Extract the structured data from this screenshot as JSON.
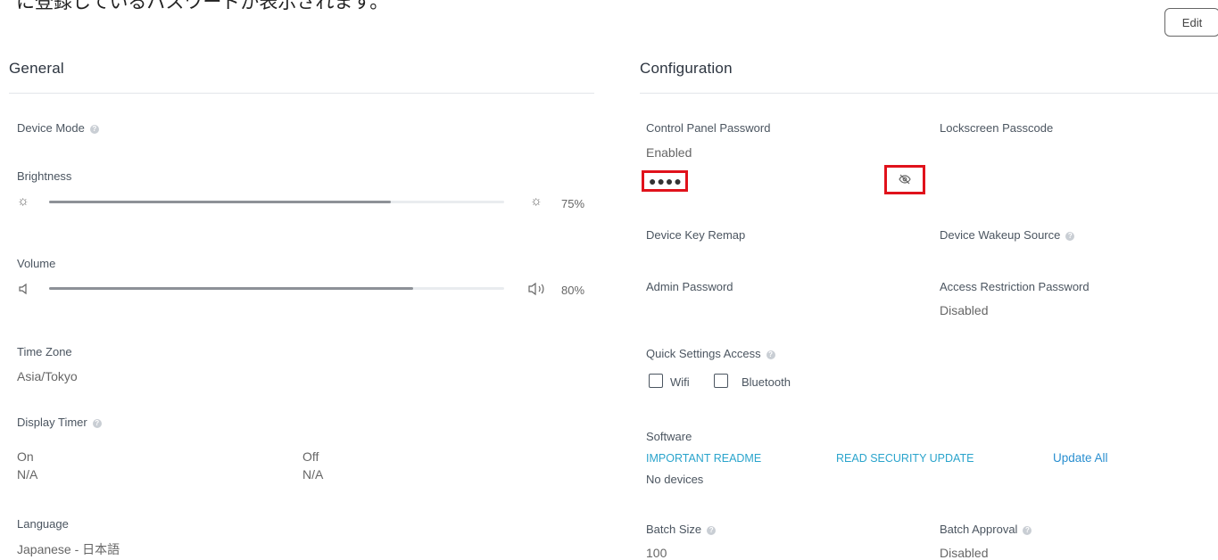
{
  "header": {
    "note_text": "に登録しているパスワードが表示されます。",
    "edit_label": "Edit"
  },
  "general": {
    "title": "General",
    "device_mode_label": "Device Mode",
    "brightness": {
      "label": "Brightness",
      "value_text": "75%",
      "level": 0.75
    },
    "volume": {
      "label": "Volume",
      "value_text": "80%",
      "level": 0.8
    },
    "time_zone": {
      "label": "Time Zone",
      "value": "Asia/Tokyo"
    },
    "display_timer": {
      "label": "Display Timer",
      "on_label": "On",
      "on_value": "N/A",
      "off_label": "Off",
      "off_value": "N/A"
    },
    "language": {
      "label": "Language",
      "value": "Japanese - 日本語"
    }
  },
  "configuration": {
    "title": "Configuration",
    "control_panel_password": {
      "label": "Control Panel Password",
      "status": "Enabled",
      "masked": "●●●●"
    },
    "lockscreen_passcode": {
      "label": "Lockscreen Passcode"
    },
    "device_key_remap": {
      "label": "Device Key Remap"
    },
    "device_wakeup_source": {
      "label": "Device Wakeup Source"
    },
    "admin_password": {
      "label": "Admin Password"
    },
    "access_restriction_password": {
      "label": "Access Restriction Password",
      "value": "Disabled"
    },
    "quick_settings_access": {
      "label": "Quick Settings Access",
      "wifi_label": "Wifi",
      "bluetooth_label": "Bluetooth"
    },
    "software": {
      "label": "Software",
      "important_readme": "IMPORTANT README",
      "read_security_update": "READ SECURITY UPDATE",
      "update_all": "Update All",
      "devices_text": "No devices"
    },
    "batch_size": {
      "label": "Batch Size",
      "value": "100"
    },
    "batch_approval": {
      "label": "Batch Approval",
      "value": "Disabled"
    }
  },
  "colors": {
    "highlight_red": "#e0121b",
    "link_teal": "#2aa4cc",
    "link_blue": "#2a8fd0"
  },
  "icons": [
    "help-icon",
    "sun-icon",
    "speaker-icon",
    "eye-off-icon"
  ]
}
